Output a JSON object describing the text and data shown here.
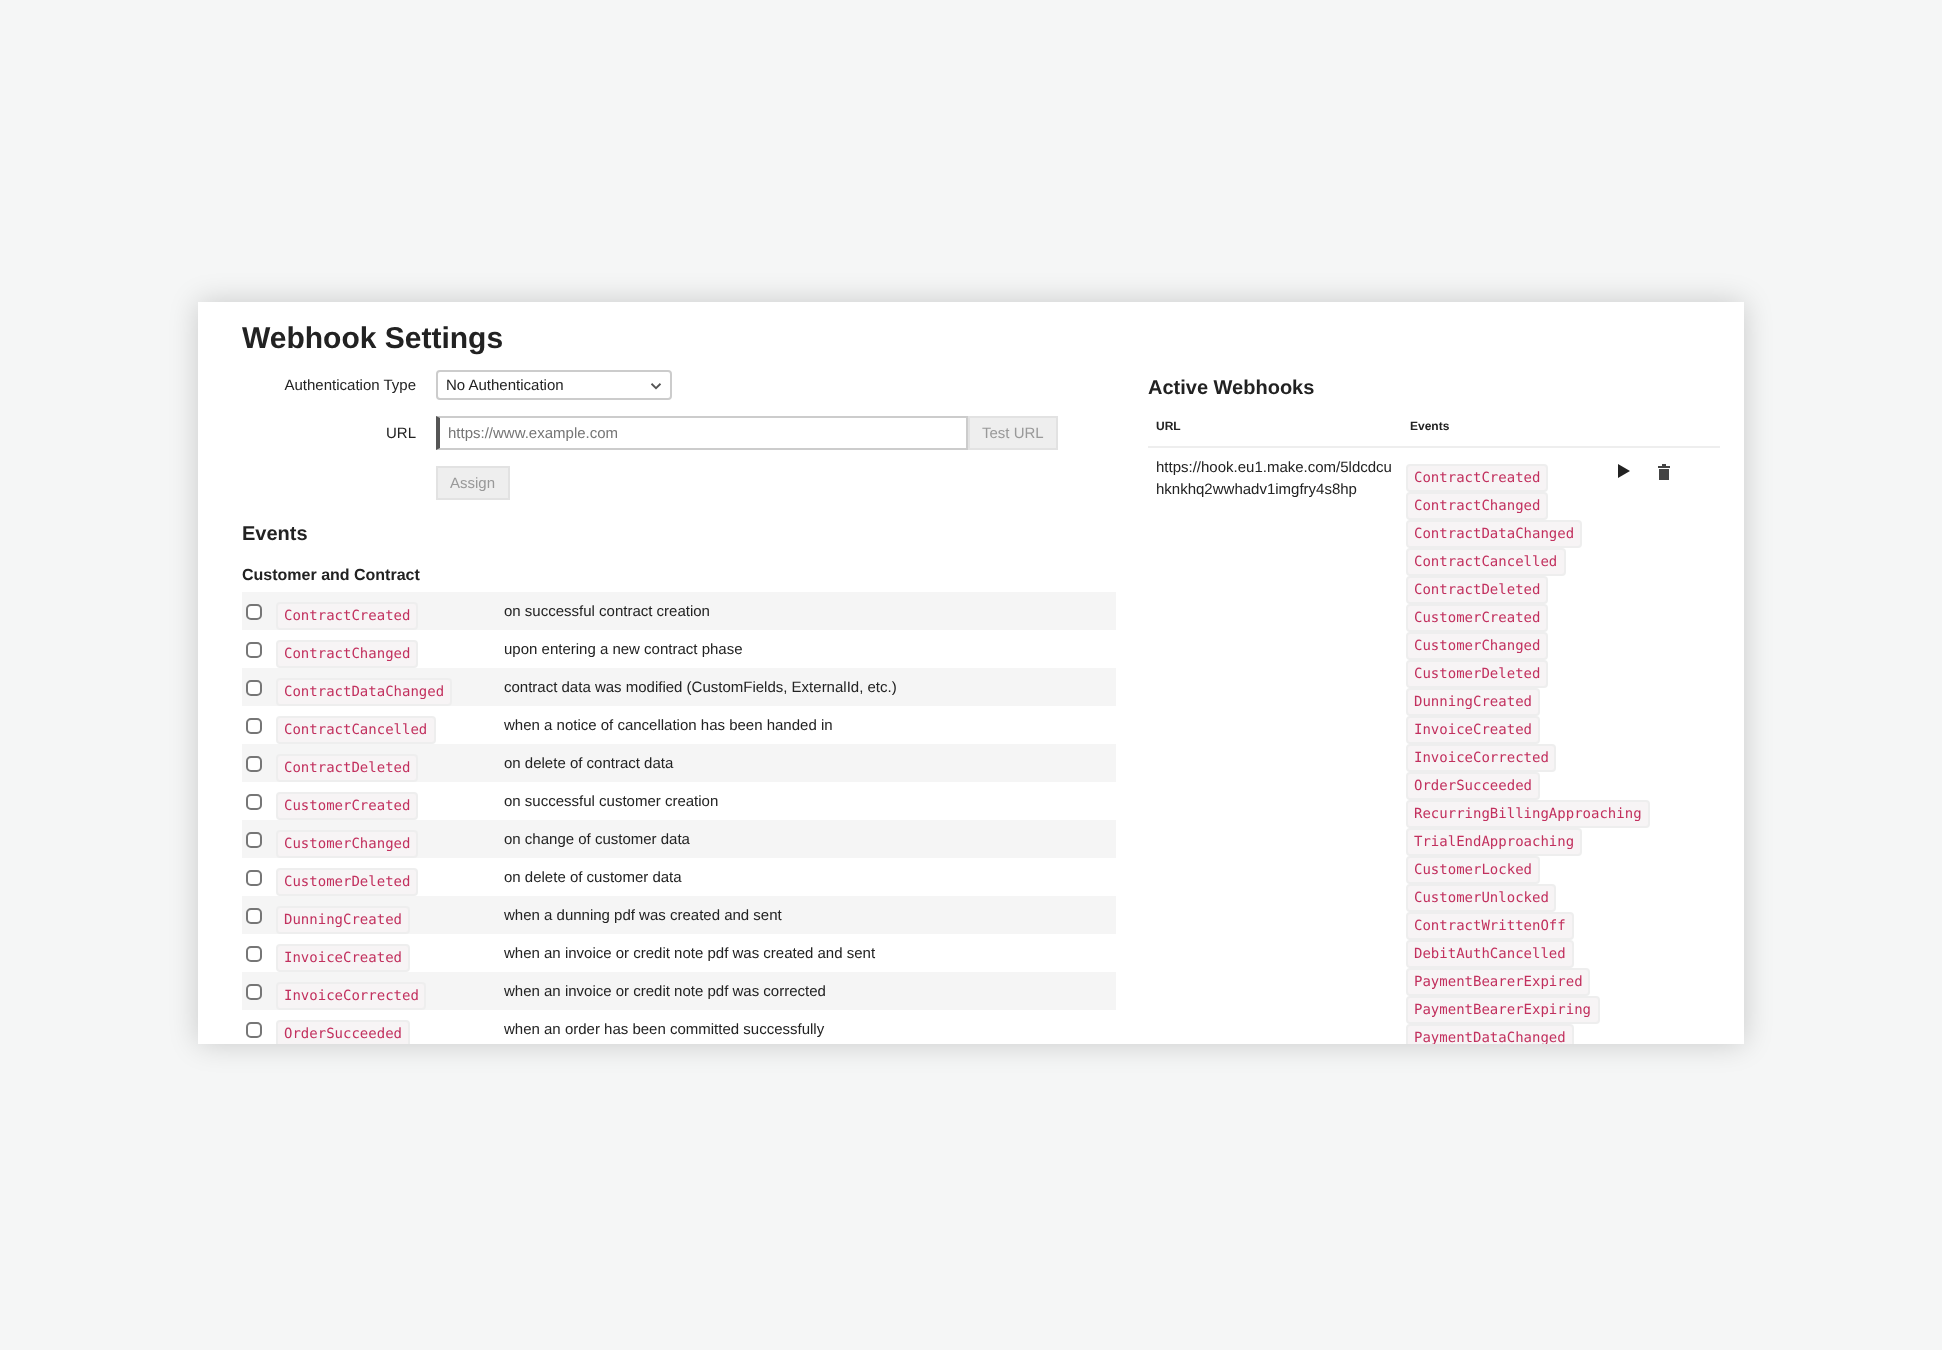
{
  "title": "Webhook Settings",
  "auth": {
    "label": "Authentication Type",
    "value": "No Authentication"
  },
  "url": {
    "label": "URL",
    "placeholder": "https://www.example.com",
    "test_button": "Test URL"
  },
  "assign_button": {
    "label": "Assign",
    "disabled": true
  },
  "events_heading": "Events",
  "groups": [
    {
      "title": "Customer and Contract",
      "events": [
        {
          "name": "ContractCreated",
          "description": "on successful contract creation",
          "checked": false
        },
        {
          "name": "ContractChanged",
          "description": "upon entering a new contract phase",
          "checked": false
        },
        {
          "name": "ContractDataChanged",
          "description": "contract data was modified (CustomFields, ExternalId, etc.)",
          "checked": false
        },
        {
          "name": "ContractCancelled",
          "description": "when a notice of cancellation has been handed in",
          "checked": false
        },
        {
          "name": "ContractDeleted",
          "description": "on delete of contract data",
          "checked": false
        },
        {
          "name": "CustomerCreated",
          "description": "on successful customer creation",
          "checked": false
        },
        {
          "name": "CustomerChanged",
          "description": "on change of customer data",
          "checked": false
        },
        {
          "name": "CustomerDeleted",
          "description": "on delete of customer data",
          "checked": false
        },
        {
          "name": "DunningCreated",
          "description": "when a dunning pdf was created and sent",
          "checked": false
        },
        {
          "name": "InvoiceCreated",
          "description": "when an invoice or credit note pdf was created and sent",
          "checked": false
        },
        {
          "name": "InvoiceCorrected",
          "description": "when an invoice or credit note pdf was corrected",
          "checked": false
        },
        {
          "name": "OrderSucceeded",
          "description": "when an order has been committed successfully",
          "checked": false
        }
      ]
    }
  ],
  "active_webhooks": {
    "title": "Active Webhooks",
    "columns": [
      "URL",
      "Events"
    ],
    "rows": [
      {
        "url": "https://hook.eu1.make.com/5ldcdcuhknkhq2wwhadv1imgfry4s8hp",
        "events": [
          "ContractCreated",
          "ContractChanged",
          "ContractDataChanged",
          "ContractCancelled",
          "ContractDeleted",
          "CustomerCreated",
          "CustomerChanged",
          "CustomerDeleted",
          "DunningCreated",
          "InvoiceCreated",
          "InvoiceCorrected",
          "OrderSucceeded",
          "RecurringBillingApproaching",
          "TrialEndApproaching",
          "CustomerLocked",
          "CustomerUnlocked",
          "ContractWrittenOff",
          "DebitAuthCancelled",
          "PaymentBearerExpired",
          "PaymentBearerExpiring",
          "PaymentDataChanged"
        ]
      }
    ]
  }
}
